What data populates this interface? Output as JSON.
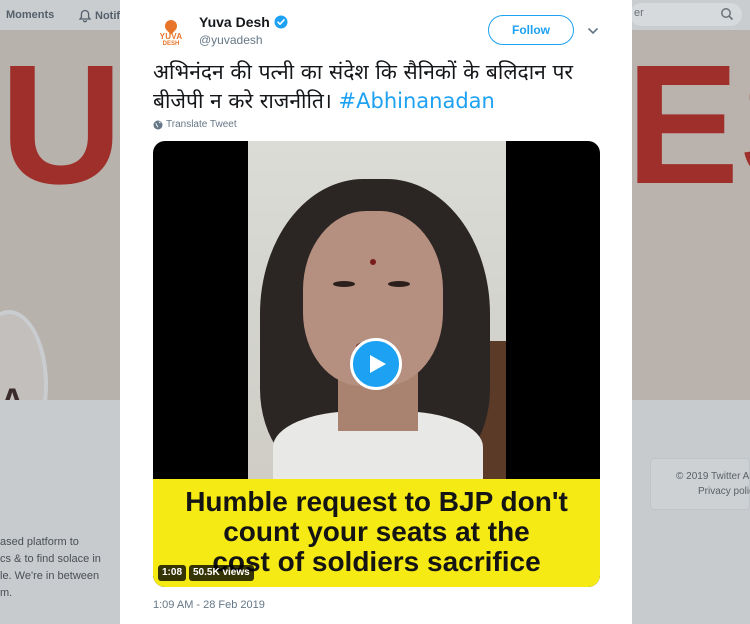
{
  "background": {
    "nav_moments": "Moments",
    "nav_notifications": "Notif",
    "search_placeholder": "er",
    "banner_letters_left": "U",
    "banner_letters_right": "ES",
    "avatar_fragment": "A",
    "bio_lines": [
      "ased platform to",
      "cs & to find solace in",
      "le. We're in between",
      "m."
    ],
    "footer_line1": "© 2019 Twitter   A",
    "footer_line2": "Privacy polic"
  },
  "tweet": {
    "avatar_text_line1": "YUVA",
    "avatar_text_line2": "DESH",
    "display_name": "Yuva Desh",
    "handle": "@yuvadesh",
    "follow_label": "Follow",
    "text_main": "अभिनंदन की पत्नी का संदेश कि सैनिकों के बलिदान पर बीजेपी न करे राजनीति। ",
    "hashtag": "#Abhinanadan",
    "translate_label": "Translate Tweet",
    "timestamp": "1:09 AM - 28 Feb 2019"
  },
  "video": {
    "caption_line1": "Humble request to BJP don't",
    "caption_line2": "count your seats at the",
    "caption_line3": "cost of soldiers sacrifice",
    "duration": "1:08",
    "views": "50.5K views"
  },
  "colors": {
    "accent": "#1da1f2",
    "caption_background": "#f5ea14"
  }
}
